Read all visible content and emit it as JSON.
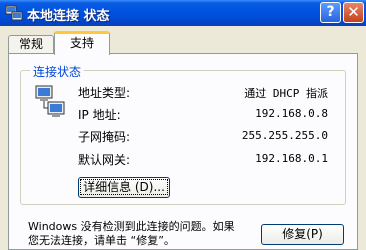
{
  "window": {
    "title": "本地连接 状态",
    "help_label": "?",
    "close_label": "✕"
  },
  "tabs": [
    {
      "label": "常规"
    },
    {
      "label": "支持"
    }
  ],
  "group": {
    "label": "连接状态",
    "rows": [
      {
        "label": "地址类型:",
        "value": "通过 DHCP 指派"
      },
      {
        "label": "IP 地址:",
        "value": "192.168.0.8"
      },
      {
        "label": "子网掩码:",
        "value": "255.255.255.0"
      },
      {
        "label": "默认网关:",
        "value": "192.168.0.1"
      }
    ],
    "details_button": "详细信息 (D)..."
  },
  "footer": {
    "message_line1": "Windows 没有检测到此连接的问题。如果",
    "message_line2": "您无法连接，请单击 “修复”。",
    "repair_button": "修复(P)"
  }
}
